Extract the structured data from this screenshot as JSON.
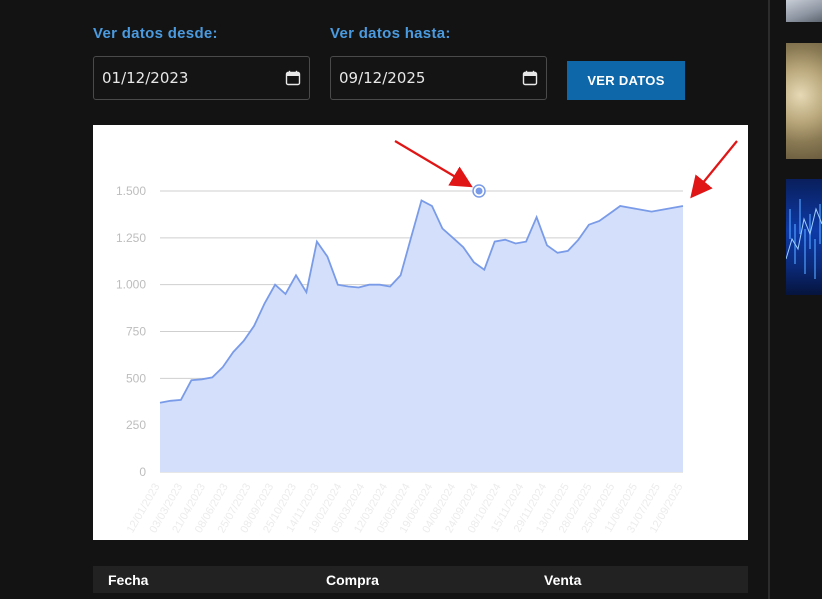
{
  "filters": {
    "from_label": "Ver datos desde:",
    "to_label": "Ver datos hasta:",
    "from_value": "01/12/2023",
    "to_value": "09/12/2025",
    "submit_label": "VER DATOS"
  },
  "colors": {
    "accent_label": "#4a9be0",
    "button": "#0e67a8",
    "line": "#7a9be8",
    "area": "#d4e0fb",
    "annotation_arrow": "#e01616"
  },
  "chart_data": {
    "type": "area",
    "ylim": [
      0,
      1500
    ],
    "yticks": [
      "0",
      "250",
      "500",
      "750",
      "1.000",
      "1.250",
      "1.500"
    ],
    "ytick_values": [
      0,
      250,
      500,
      750,
      1000,
      1250,
      1500
    ],
    "xtick_labels": [
      "12/01/2023",
      "03/03/2023",
      "21/04/2023",
      "08/06/2023",
      "25/07/2023",
      "08/09/2023",
      "25/10/2023",
      "14/11/2023",
      "19/02/2024",
      "05/03/2024",
      "12/03/2024",
      "05/05/2024",
      "19/06/2024",
      "04/08/2024",
      "24/09/2024",
      "08/10/2024",
      "15/11/2024",
      "29/11/2024",
      "13/01/2025",
      "28/02/2025",
      "25/04/2025",
      "11/06/2025",
      "31/07/2025",
      "12/09/2025"
    ],
    "grid": true,
    "x": [
      0,
      2,
      4,
      6,
      8,
      10,
      12,
      14,
      16,
      18,
      20,
      22,
      24,
      26,
      28,
      30,
      32,
      34,
      36,
      38,
      40,
      42,
      44,
      46,
      48,
      50,
      52,
      54,
      56,
      58,
      60,
      62,
      64,
      66,
      68,
      70,
      72,
      74,
      76,
      78,
      80,
      82,
      84,
      86,
      88,
      90,
      92,
      94,
      96,
      98,
      100
    ],
    "values": [
      370,
      380,
      385,
      490,
      495,
      505,
      560,
      640,
      700,
      780,
      900,
      1000,
      950,
      1050,
      960,
      1230,
      1150,
      1000,
      990,
      985,
      1000,
      1000,
      990,
      1050,
      1250,
      1450,
      1420,
      1300,
      1250,
      1200,
      1120,
      1080,
      1230,
      1240,
      1220,
      1230,
      1360,
      1210,
      1170,
      1180,
      1240,
      1320,
      1340,
      1380,
      1420,
      1410,
      1400,
      1390,
      1400,
      1410,
      1420
    ],
    "highlight_point": {
      "x": 61.0,
      "y": 1500
    }
  },
  "table": {
    "headers": [
      "Fecha",
      "Compra",
      "Venta"
    ]
  }
}
